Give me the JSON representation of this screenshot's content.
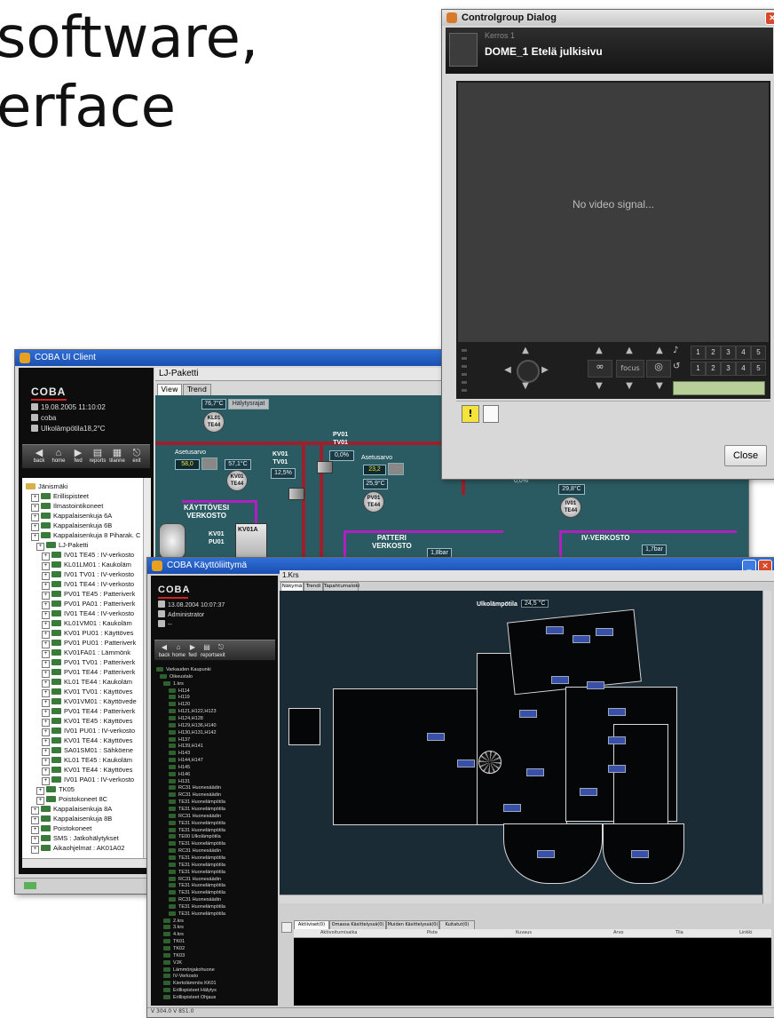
{
  "slide": {
    "line1": "software,",
    "line2": "erface"
  },
  "controlgroup": {
    "title": "Controlgroup Dialog",
    "floor": "Kerros 1",
    "camera": "DOME_1 Etelä julkisivu",
    "video_message": "No video signal...",
    "focus_label": "focus",
    "preset_row1": [
      "1",
      "2",
      "3",
      "4",
      "5"
    ],
    "preset_row2": [
      "1",
      "2",
      "3",
      "4",
      "5"
    ],
    "close_label": "Close"
  },
  "uiclient": {
    "title": "COBA UI Client",
    "logo": "COBA",
    "datetime": "19.08.2005 11:10:02",
    "user": "coba",
    "outdoor": "Ulkolämpötila18,2°C",
    "toolbar": [
      "back",
      "home",
      "fwd",
      "reports",
      "tilanne",
      "exit"
    ],
    "tree": [
      "Jänismäki",
      "Erillispisteet",
      "Ilmastointikoneet",
      "Kappalaisenkuja 6A",
      "Kappalaisenkuja 6B",
      "Kappalaisenkuja 8 Piharak. C",
      "LJ-Paketti",
      "IV01 TE45 : IV-verkosto",
      "KL01LM01 : Kaukoläm",
      "IV01 TV01 : IV-verkosto",
      "IV01 TE44 : IV-verkosto",
      "PV01 TE45 : Patteriverk",
      "PV01 PA01 : Patteriverk",
      "IV01 TE44 : IV-verkosto",
      "KL01VM01 : Kaukoläm",
      "KV01 PU01 : Käyttöves",
      "PV01 PU01 : Patteriverk",
      "KV01FA01 : Lämmönk",
      "PV01 TV01 : Patteriverk",
      "PV01 TE44 : Patteriverk",
      "KL01 TE44 : Kaukoläm",
      "KV01 TV01 : Käyttöves",
      "KV01VM01 : Käyttövede",
      "PV01 TE44 : Patteriverk",
      "KV01 TE45 : Käyttöves",
      "IV01 PU01 : IV-verkosto",
      "KV01 TE44 : Käyttöves",
      "SA01SM01 : Sähköene",
      "KL01 TE45 : Kaukoläm",
      "KV01 TE44 : Käyttöves",
      "IV01 PA01 : IV-verkosto",
      "TK05",
      "Poistokoneet 8C",
      "Kappalaisenkuja 8A",
      "Kappalaisenkuja 8B",
      "Poistokoneet",
      "SMS : Jatkohälytykset",
      "Aikaohjelmat : AK01A02"
    ],
    "panel_title": "LJ-Paketti",
    "tabs": [
      "View",
      "Trend"
    ],
    "process": {
      "top_temp": "76,7°C",
      "alarm_limits": "Hälytysrajat",
      "kl01": "KL01\nTE44",
      "asetusarvo1_label": "Asetusarvo",
      "asetusarvo1": "58,0",
      "kv01_temp": "57,1°C",
      "kv01_dev": "KV01\nTE44",
      "kv01_tv01": "KV01\nTV01",
      "kv01_pct": "12,5%",
      "pv01_tv01": "PV01\nTV01",
      "pv01_pct": "0,0%",
      "asetusarvo2_label": "Asetusarvo",
      "asetusarvo2": "23,2",
      "pv01_temp": "25,9°C",
      "pv01_dev": "PV01\nTE44",
      "kayttovesi": "KÄYTTÖVESI\nVERKOSTO",
      "kv01_pu01": "KV01\nPU01",
      "kv01a": "KV01A",
      "patteri": "PATTERI\nVERKOSTO",
      "pressure1": "1,8bar",
      "right_pct": "0,0%",
      "iv01_temp": "29,8°C",
      "iv01_dev": "IV01\nTE44",
      "iv_verkosto": "IV-VERKOSTO",
      "pressure2": "1,7bar",
      "pv01_bottom": "PV01"
    }
  },
  "kaytto": {
    "title": "COBA Käyttöliittymä",
    "logo": "COBA",
    "datetime": "13.08.2004 10:07:37",
    "user": "Administrator",
    "extra": "--",
    "toolbar": [
      "back",
      "home",
      "fwd",
      "reports",
      "exit"
    ],
    "panel_title": "1.Krs",
    "tabs": [
      "Näkymä",
      "Trendi",
      "Tapahtumaloki"
    ],
    "outdoor_label": "Ulkolämpötila",
    "outdoor_value": "24,5 °C",
    "tree": [
      "Varkauden Kaupunki",
      "Oikeustalo",
      "1.krs",
      "H114",
      "H119",
      "H120",
      "H121,H122,H123",
      "H124,H128",
      "H129,H136,H140",
      "H130,H131,H142",
      "H137",
      "H139,H141",
      "H143",
      "H144,H147",
      "H145",
      "H146",
      "H131",
      "RC31 Huonesäädin",
      "RC31 Huonesäädin",
      "TE31 Huonelämpötila",
      "TE31 Huonelämpötila",
      "RC31 Huonesäädin",
      "TE31 Huonelämpötila",
      "TE31 Huonelämpötila",
      "TE00 Ulkolämpötila",
      "TE31 Huonelämpötila",
      "RC31 Huonesäädin",
      "TE31 Huonelämpötila",
      "TE31 Huonelämpötila",
      "TE31 Huonelämpötila",
      "RC31 Huonesäädin",
      "TE31 Huonelämpötila",
      "TE31 Huonelämpötila",
      "RC31 Huonesäädin",
      "TE31 Huonelämpötila",
      "TE31 Huonelämpötila",
      "2.krs",
      "3.krs",
      "4.krs",
      "TK01",
      "TK02",
      "TK03",
      "VJK",
      "Lämmönjakohuone",
      "IV-Verkosto",
      "Kiertolämmös KK01",
      "Erillispisteet Hälytys",
      "Erillispisteet Ohjaus"
    ],
    "alarm_tabs": [
      "Aktiiviset(0)",
      "Omassa Käsittelyssä(0)",
      "Muiden Käsittelyssä(0)",
      "Kuitatut(0)"
    ],
    "alarm_columns": [
      "Aktivoitumisaika",
      "Piste",
      "Kuvaus",
      "Arvo",
      "Tila",
      "Linkki"
    ],
    "version": "V 304.0 V 851.0"
  },
  "colors": {
    "title_bar": "#1b4fb0",
    "process_bg": "#2b5b62",
    "pipe_red": "#9c1f2b",
    "pipe_magenta": "#b020c0",
    "plan_bg": "#1a2b36",
    "accent_green": "#b9cf9a"
  }
}
